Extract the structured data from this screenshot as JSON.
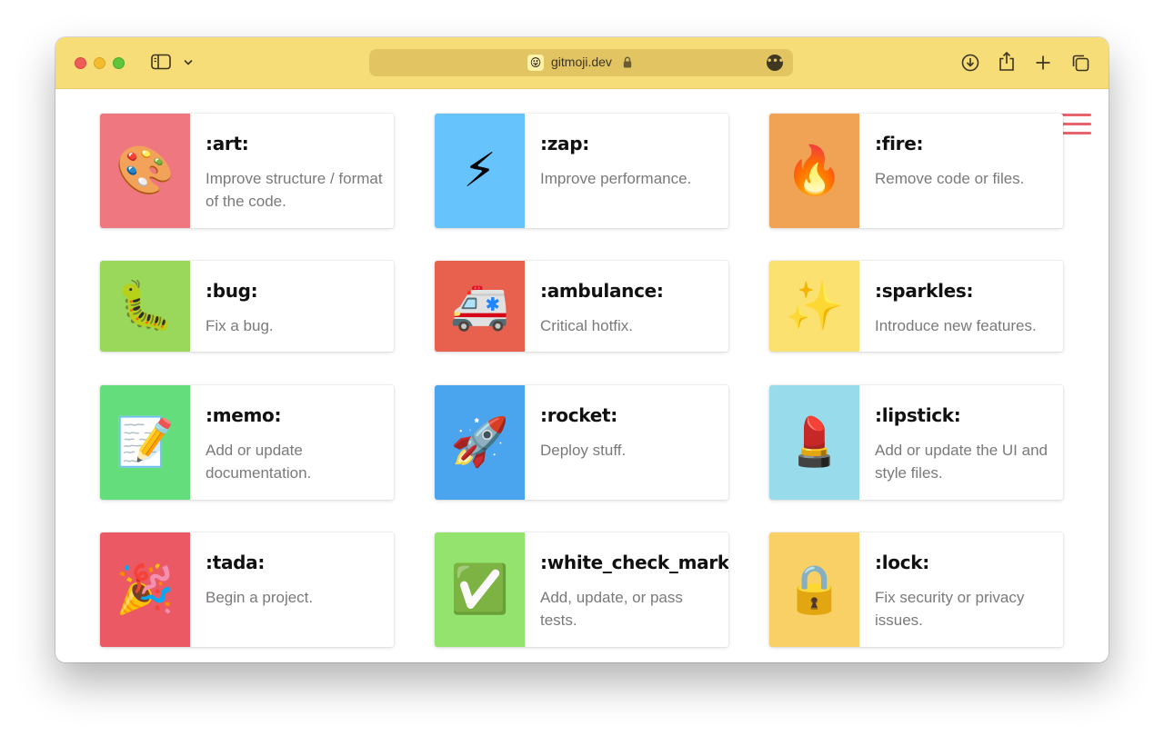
{
  "browser": {
    "url": "gitmoji.dev",
    "favicon": "😜"
  },
  "menu": {
    "icon": "hamburger-menu-icon"
  },
  "gitmojis": [
    {
      "code": ":art:",
      "description": "Improve structure / format of the code.",
      "emoji": "🎨",
      "color": "#ef7880"
    },
    {
      "code": ":zap:",
      "description": "Improve performance.",
      "emoji": "⚡",
      "color": "#66c3fb"
    },
    {
      "code": ":fire:",
      "description": "Remove code or files.",
      "emoji": "🔥",
      "color": "#f0a255"
    },
    {
      "code": ":bug:",
      "description": "Fix a bug.",
      "emoji": "🐛",
      "color": "#99d85b"
    },
    {
      "code": ":ambulance:",
      "description": "Critical hotfix.",
      "emoji": "🚑",
      "color": "#e8614f"
    },
    {
      "code": ":sparkles:",
      "description": "Introduce new features.",
      "emoji": "✨",
      "color": "#fbe170"
    },
    {
      "code": ":memo:",
      "description": "Add or update documentation.",
      "emoji": "📝",
      "color": "#64de7c"
    },
    {
      "code": ":rocket:",
      "description": "Deploy stuff.",
      "emoji": "🚀",
      "color": "#4aa5ee"
    },
    {
      "code": ":lipstick:",
      "description": "Add or update the UI and style files.",
      "emoji": "💄",
      "color": "#98dbea"
    },
    {
      "code": ":tada:",
      "description": "Begin a project.",
      "emoji": "🎉",
      "color": "#ea5964"
    },
    {
      "code": ":white_check_mark:",
      "description": "Add, update, or pass tests.",
      "emoji": "✅",
      "color": "#94e36e"
    },
    {
      "code": ":lock:",
      "description": "Fix security or privacy issues.",
      "emoji": "🔒",
      "color": "#f8d065"
    }
  ]
}
